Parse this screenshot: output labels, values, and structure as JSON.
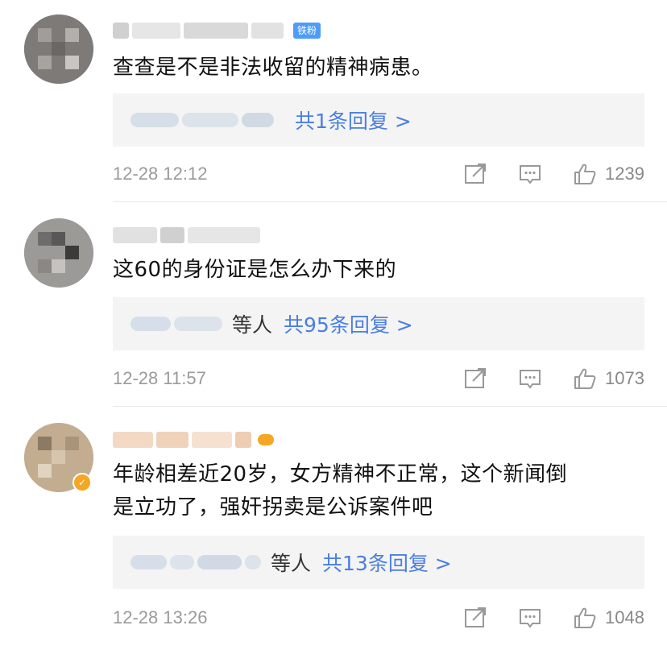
{
  "comments": [
    {
      "badge": "铁粉",
      "text_lines": [
        "查查是不是非法收留的精神病患。"
      ],
      "reply_suffix": "",
      "reply_count": "共1条回复 >",
      "time": "12-28 12:12",
      "likes": "1239"
    },
    {
      "badge": "",
      "text_lines": [
        "这60的身份证是怎么办下来的"
      ],
      "reply_suffix": "等人",
      "reply_count": "共95条回复 >",
      "time": "12-28 11:57",
      "likes": "1073"
    },
    {
      "badge": "",
      "text_lines": [
        "年龄相差近20岁，女方精神不正常，这个新闻倒",
        "是立功了，强奸拐卖是公诉案件吧"
      ],
      "reply_suffix": "等人",
      "reply_count": "共13条回复 >",
      "time": "12-28 13:26",
      "likes": "1048"
    }
  ],
  "icons": {
    "share": "share-icon",
    "comment": "comment-icon",
    "like": "thumbs-up-icon"
  },
  "colors": {
    "link_blue": "#4a7ee3",
    "fan_badge": "#4d9cf7",
    "verified_orange": "#f5a623",
    "reply_bg": "#f4f4f4"
  }
}
